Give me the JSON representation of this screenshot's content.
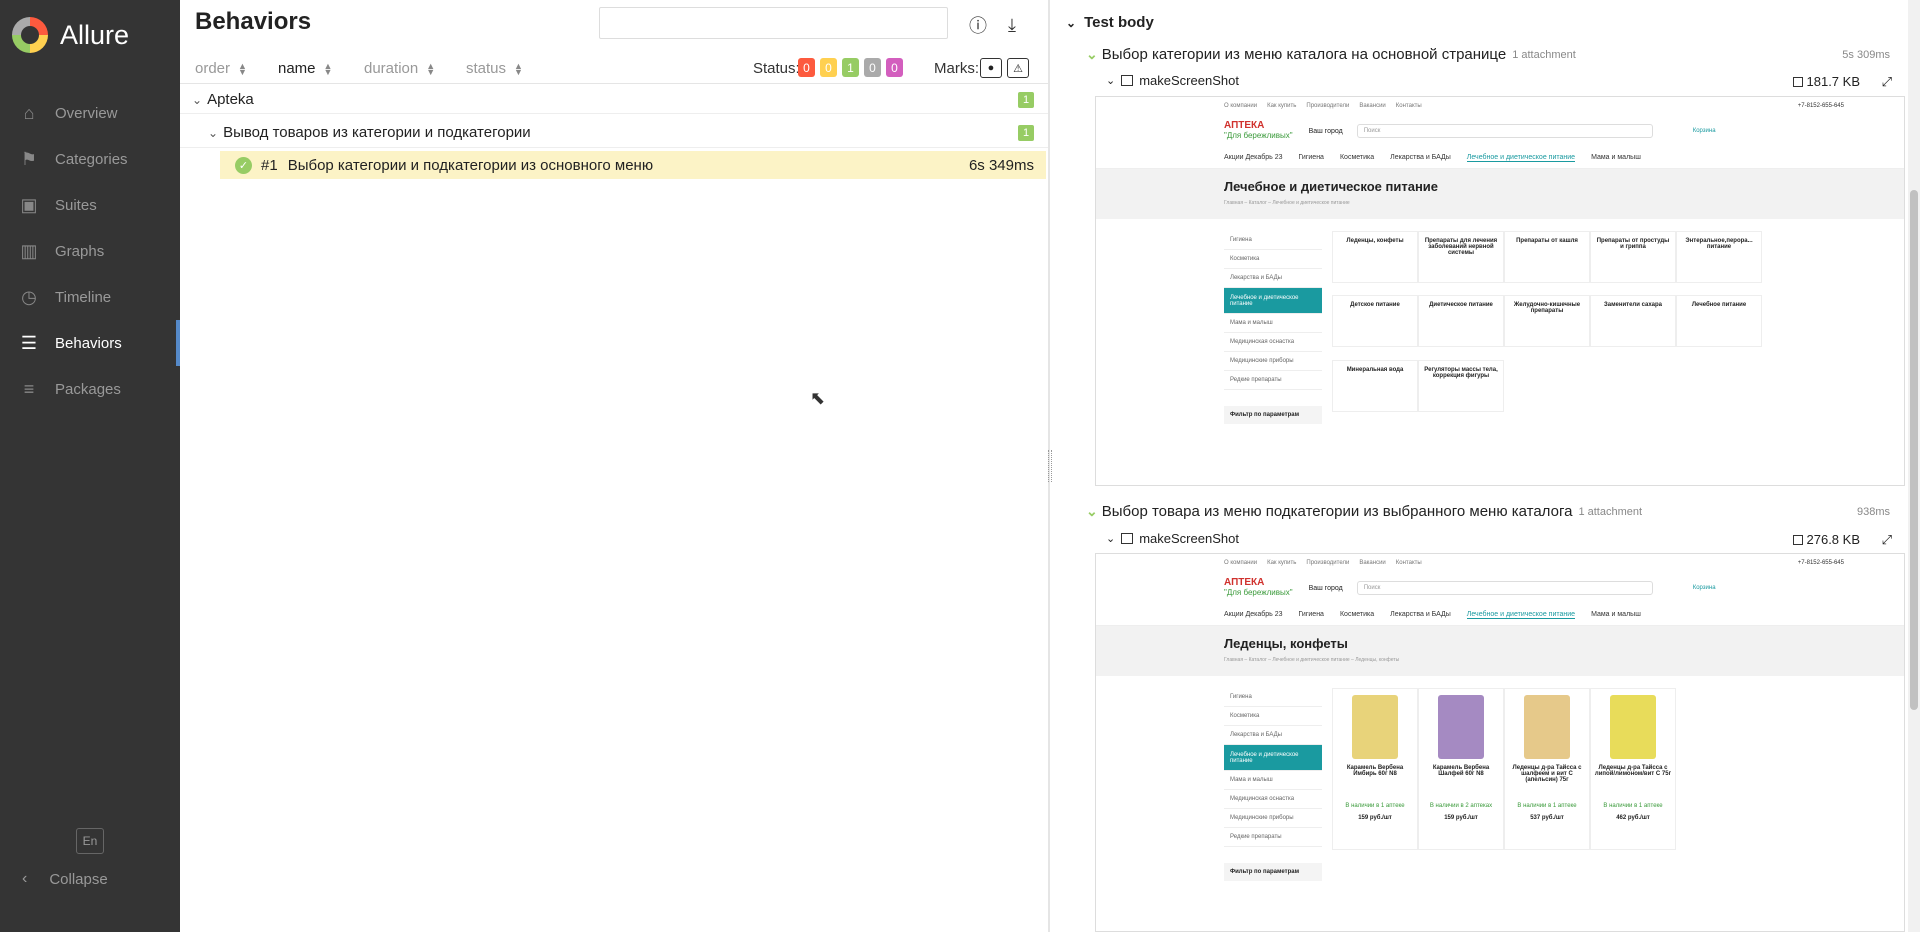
{
  "app": {
    "name": "Allure"
  },
  "sidebar": {
    "items": [
      {
        "label": "Overview",
        "icon": "home-icon"
      },
      {
        "label": "Categories",
        "icon": "flag-icon"
      },
      {
        "label": "Suites",
        "icon": "briefcase-icon"
      },
      {
        "label": "Graphs",
        "icon": "bar-chart-icon"
      },
      {
        "label": "Timeline",
        "icon": "clock-icon"
      },
      {
        "label": "Behaviors",
        "icon": "list-icon",
        "active": true
      },
      {
        "label": "Packages",
        "icon": "align-left-icon"
      }
    ],
    "language": "En",
    "collapse_label": "Collapse"
  },
  "behaviors": {
    "title": "Behaviors",
    "search": {
      "value": "",
      "placeholder": ""
    },
    "sort": {
      "order": "order",
      "name": "name",
      "duration": "duration",
      "status": "status"
    },
    "status_label": "Status:",
    "status_counts": [
      {
        "value": "0",
        "color": "#fd5a3e"
      },
      {
        "value": "0",
        "color": "#ffd050"
      },
      {
        "value": "1",
        "color": "#97cc64"
      },
      {
        "value": "0",
        "color": "#aaaaaa"
      },
      {
        "value": "0",
        "color": "#d35ebe"
      }
    ],
    "marks_label": "Marks:",
    "tree": {
      "feature": {
        "name": "Apteka",
        "count": "1"
      },
      "story": {
        "name": "Вывод товаров из категории и подкатегории",
        "count": "1"
      },
      "test": {
        "index": "#1",
        "name": "Выбор категории и подкатегории из основного меню",
        "duration": "6s 349ms"
      }
    }
  },
  "test_body": {
    "heading": "Test body",
    "steps": [
      {
        "name": "Выбор категории из меню каталога на основной странице",
        "attachments": "1 attachment",
        "time": "5s 309ms",
        "attachment": {
          "name": "makeScreenShot",
          "size": "181.7 KB"
        }
      },
      {
        "name": "Выбор товара из меню подкатегории из выбранного меню каталога",
        "attachments": "1 attachment",
        "time": "938ms",
        "attachment": {
          "name": "makeScreenShot",
          "size": "276.8 KB"
        }
      }
    ]
  },
  "screenshot1": {
    "top_links": [
      "О компании",
      "Как купить",
      "Производители",
      "Вакансии",
      "Контакты"
    ],
    "phone": "+7-8152-655-645",
    "logo": "АПТЕКА",
    "logo_sub": "\"Для бережливых\"",
    "city": "Ваш город",
    "search_placeholder": "Поиск",
    "cart": "Корзина",
    "menu": [
      "Акции Декабрь 23",
      "Гигиена",
      "Косметика",
      "Лекарства и БАДы",
      "Лечебное и диетическое питание",
      "Мама и малыш"
    ],
    "heading": "Лечебное и диетическое питание",
    "breadcrumb": "Главная – Каталог – Лечебное и диетическое питание",
    "side": [
      "Гигиена",
      "Косметика",
      "Лекарства и БАДы",
      "Лечебное и диетическое питание",
      "Мама и малыш",
      "Медицинская оснастка",
      "Медицинские приборы",
      "Редкие препараты"
    ],
    "filter": "Фильтр по параметрам",
    "categories": [
      "Леденцы, конфеты",
      "Препараты для лечения заболеваний нервной системы",
      "Препараты от кашля",
      "Препараты от простуды и гриппа",
      "Энтеральное,перора... питание",
      "Детское питание",
      "Диетическое питание",
      "Желудочно-кишечные препараты",
      "Заменители сахара",
      "Лечебное питание",
      "Минеральная вода",
      "Регуляторы массы тела, коррекция фигуры"
    ]
  },
  "screenshot2": {
    "heading": "Леденцы, конфеты",
    "breadcrumb": "Главная – Каталог – Лечебное и диетическое питание – Леденцы, конфеты",
    "products": [
      {
        "name": "Карамель Вербена Имбирь 60г N8",
        "stock": "В наличии в 1 аптеке",
        "price": "159 руб./шт",
        "color": "#e8d37a"
      },
      {
        "name": "Карамель Вербена Шалфей 60г N8",
        "stock": "В наличии в 2 аптеках",
        "price": "159 руб./шт",
        "color": "#a58ac2"
      },
      {
        "name": "Леденцы д-ра Тайсса с шалфеем и вит С (апельсин) 75г",
        "stock": "В наличии в 1 аптеке",
        "price": "537 руб./шт",
        "color": "#e6c98a"
      },
      {
        "name": "Леденцы д-ра Тайсса с липой/лимоном/вит С 75г",
        "stock": "В наличии в 1 аптеке",
        "price": "462 руб./шт",
        "color": "#e8dc5a"
      }
    ]
  }
}
